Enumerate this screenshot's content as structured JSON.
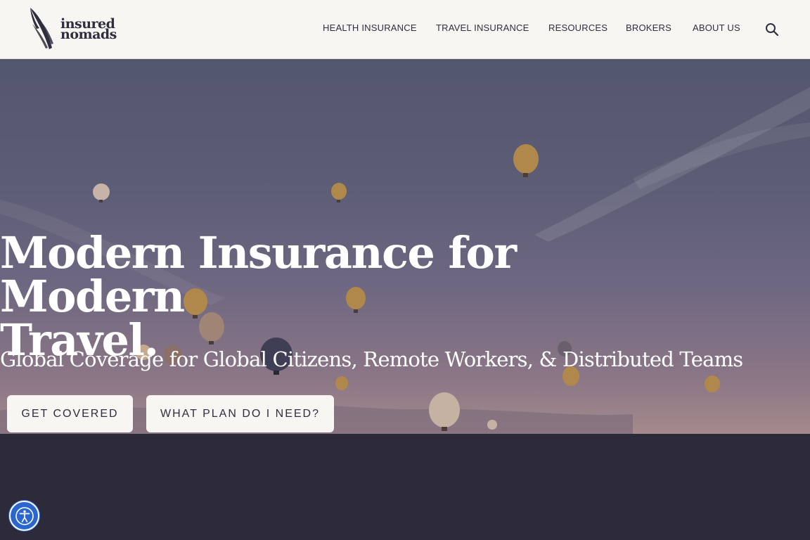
{
  "header": {
    "logo": {
      "line1": "insured",
      "line2": "nomads",
      "icon": "feather-logo-icon"
    },
    "nav": [
      {
        "label": "HEALTH INSURANCE"
      },
      {
        "label": "TRAVEL INSURANCE"
      },
      {
        "label": "RESOURCES"
      },
      {
        "label": "BROKERS"
      },
      {
        "label": "ABOUT US"
      }
    ],
    "search_icon": "search-icon"
  },
  "hero": {
    "headline_line1": "Modern Insurance for Modern",
    "headline_line2": "Travel.",
    "subheadline": "Global Coverage for Global Citizens, Remote Workers, & Distributed Teams",
    "primary_cta": "GET COVERED",
    "secondary_cta": "WHAT PLAN DO I NEED?",
    "background": "hot-air-balloons-sky-image"
  },
  "accessibility": {
    "icon": "accessibility-icon"
  },
  "colors": {
    "header_bg": "#f8f6f2",
    "text_dark": "#2f2e3e",
    "dark_section": "#2d2b3a",
    "accessibility_blue": "#2b66cf"
  }
}
